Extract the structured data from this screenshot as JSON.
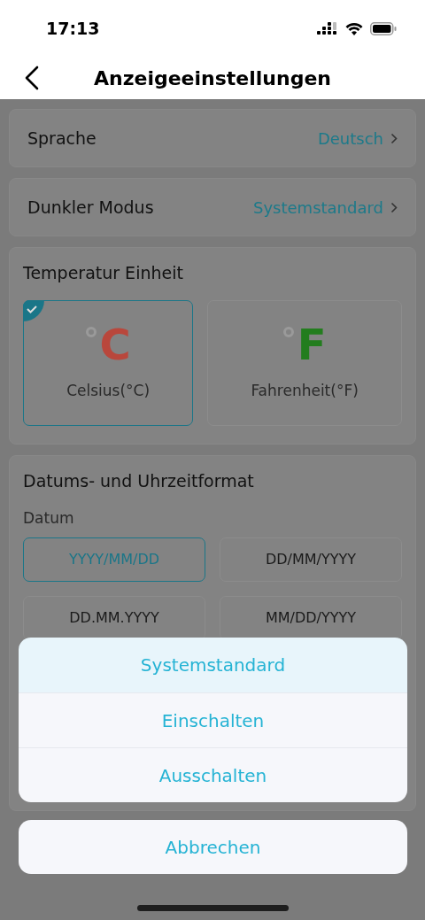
{
  "status_bar": {
    "time": "17:13"
  },
  "header": {
    "title": "Anzeigeeinstellungen"
  },
  "settings": [
    {
      "label": "Sprache",
      "value": "Deutsch"
    },
    {
      "label": "Dunkler Modus",
      "value": "Systemstandard"
    }
  ],
  "temperature": {
    "title": "Temperatur Einheit",
    "options": [
      {
        "symbol": "C",
        "label": "Celsius(°C)",
        "color": "#b9473c",
        "selected": true
      },
      {
        "symbol": "F",
        "label": "Fahrenheit(°F)",
        "color": "#237d1e",
        "selected": false
      }
    ]
  },
  "datetime": {
    "title": "Datums- und Uhrzeitformat",
    "date_label": "Datum",
    "date_options": [
      {
        "label": "YYYY/MM/DD",
        "selected": true
      },
      {
        "label": "DD/MM/YYYY",
        "selected": false
      },
      {
        "label": "DD.MM.YYYY",
        "selected": false
      },
      {
        "label": "MM/DD/YYYY",
        "selected": false
      }
    ]
  },
  "action_sheet": {
    "options": [
      {
        "label": "Systemstandard",
        "selected": true
      },
      {
        "label": "Einschalten",
        "selected": false
      },
      {
        "label": "Ausschalten",
        "selected": false
      }
    ],
    "cancel": "Abbrechen"
  }
}
